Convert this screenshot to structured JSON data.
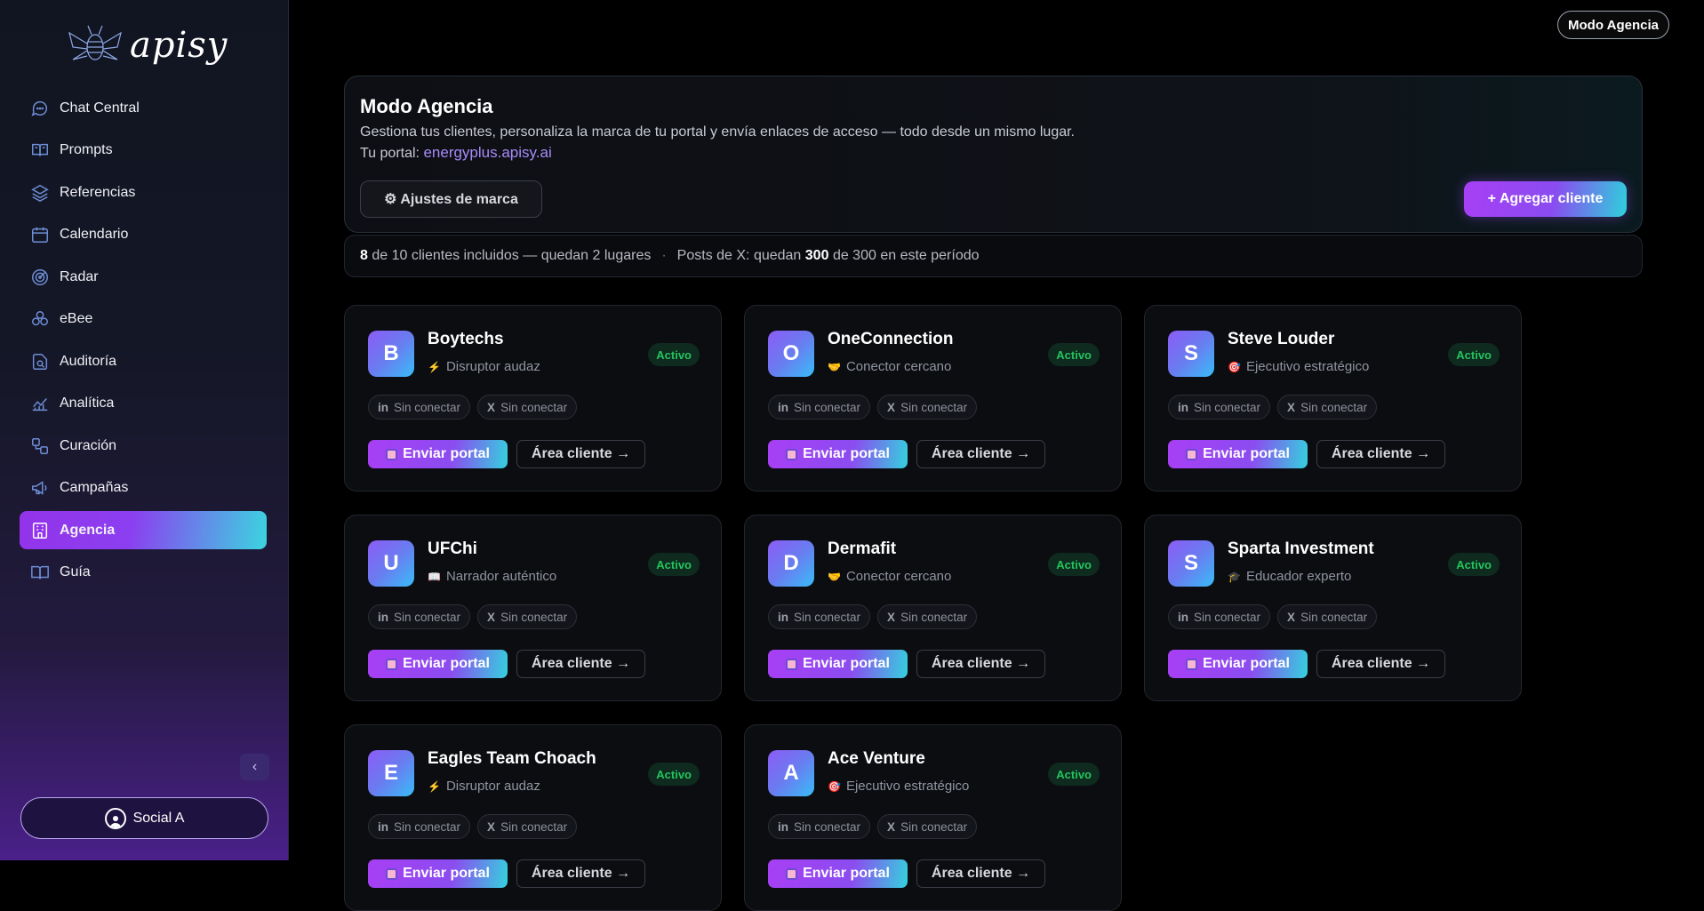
{
  "app": {
    "logo_text": "apisy"
  },
  "sidebar": {
    "items": [
      {
        "label": "Chat Central",
        "icon": "chat-icon"
      },
      {
        "label": "Prompts",
        "icon": "book-icon"
      },
      {
        "label": "Referencias",
        "icon": "layers-icon"
      },
      {
        "label": "Calendario",
        "icon": "calendar-icon"
      },
      {
        "label": "Radar",
        "icon": "radar-icon"
      },
      {
        "label": "eBee",
        "icon": "hexagons-icon"
      },
      {
        "label": "Auditoría",
        "icon": "audit-search-icon"
      },
      {
        "label": "Analítica",
        "icon": "analytics-icon"
      },
      {
        "label": "Curación",
        "icon": "curation-icon"
      },
      {
        "label": "Campañas",
        "icon": "megaphone-icon"
      },
      {
        "label": "Agencia",
        "icon": "building-icon",
        "active": true
      },
      {
        "label": "Guía",
        "icon": "open-book-icon"
      }
    ],
    "collapse_glyph": "‹",
    "user_label": "Social A"
  },
  "header": {
    "mode_pill": "Modo Agencia"
  },
  "hero": {
    "title": "Modo Agencia",
    "description": "Gestiona tus clientes, personaliza la marca de tu portal y envía enlaces de acceso — todo desde un mismo lugar.",
    "portal_prefix": "Tu portal:",
    "portal_url": "energyplus.apisy.ai",
    "brand_button": "⚙ Ajustes de marca",
    "add_button": "+ Agregar cliente"
  },
  "quota": {
    "clients_used": "8",
    "clients_text": "de 10 clientes incluidos — quedan 2 lugares",
    "sep": "·",
    "posts_prefix": "Posts de X: quedan",
    "posts_left": "300",
    "posts_suffix": "de 300 en este período"
  },
  "colors": {
    "accent_purple": "#a83ff5",
    "accent_cyan": "#2ed1dc",
    "status_green": "#22c55e"
  },
  "card_labels": {
    "status": "Activo",
    "linkedin_prefix": "in",
    "x_prefix": "X",
    "disconnected": "Sin conectar",
    "send_portal": "Enviar portal",
    "client_area": "Área cliente →"
  },
  "clients": [
    {
      "initial": "B",
      "name": "Boytechs",
      "role_icon": "⚡",
      "role": "Disruptor audaz"
    },
    {
      "initial": "O",
      "name": "OneConnection",
      "role_icon": "🤝",
      "role": "Conector cercano"
    },
    {
      "initial": "S",
      "name": "Steve Louder",
      "role_icon": "🎯",
      "role": "Ejecutivo estratégico"
    },
    {
      "initial": "U",
      "name": "UFChi",
      "role_icon": "📖",
      "role": "Narrador auténtico"
    },
    {
      "initial": "D",
      "name": "Dermafit",
      "role_icon": "🤝",
      "role": "Conector cercano"
    },
    {
      "initial": "S",
      "name": "Sparta Investment",
      "role_icon": "🎓",
      "role": "Educador experto"
    },
    {
      "initial": "E",
      "name": "Eagles Team Choach",
      "role_icon": "⚡",
      "role": "Disruptor audaz"
    },
    {
      "initial": "A",
      "name": "Ace Venture",
      "role_icon": "🎯",
      "role": "Ejecutivo estratégico"
    }
  ]
}
